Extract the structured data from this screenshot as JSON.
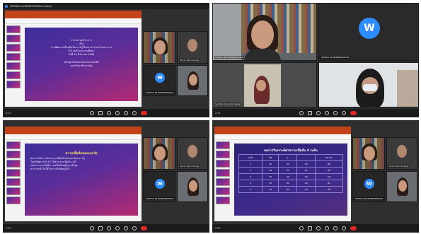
{
  "meeting": {
    "q1_title": "WIPADA MUNINNOPPAMAS (Video)",
    "q1_time": "2:15",
    "q2_time": "2:11",
    "q3_time": "2:07",
    "q4_time": "2:07"
  },
  "participants": {
    "wipada": "WIPADA MUNINNOPPAMAS",
    "sainu": "Sainu Sanomdong",
    "suchira": "Suchira Chosomchanna",
    "avatar_letter": "W"
  },
  "slides": {
    "q1_lines": [
      "การประชุมวิชาการ",
      "เรื่อง",
      "การพัฒนาเครื่องมือวัดความรู้เรื่องอาหารและโภชนาการ",
      "ในโรงเรียนประถมศึกษา",
      "วันที่ 20 สิงหาคม 2564",
      "หลักสูตรวิทยาศาสตรมหาบัณฑิต",
      "มหาวิทยาลัยราชภัฏ"
    ],
    "q3_heading": "ความเชื่อมั่นของแบบวัด",
    "q3_lines": [
      "ผลการวิเคราะห์ค่าความเชื่อมั่นของแบบวัดความรู้",
      "โดยใช้สูตร KR-20 ได้ค่าความเชื่อมั่น .80",
      "แสดงว่าแบบวัดมีความเชื่อมั่นอยู่ในระดับสูง",
      "สามารถนำไปใช้ในการเก็บข้อมูลได้"
    ],
    "q4_heading": "ผลการวิเคราะห์ค่าความเชื่อมั่น 4 ระดับ",
    "q4_table": [
      [
        "ระดับ",
        "ข้อ",
        "p",
        "r",
        "KR-20"
      ],
      [
        "1",
        "20",
        ".52",
        ".43",
        ".80"
      ],
      [
        "2",
        "20",
        ".55",
        ".41",
        ".82"
      ],
      [
        "3",
        "20",
        ".49",
        ".45",
        ".79"
      ],
      [
        "4",
        "20",
        ".51",
        ".40",
        ".81"
      ],
      [
        "5",
        "20",
        ".53",
        ".44",
        ".80"
      ]
    ]
  },
  "colors": {
    "end": "#e02828",
    "zoom_blue": "#2d8cff",
    "ribbon": "#c4441a"
  }
}
